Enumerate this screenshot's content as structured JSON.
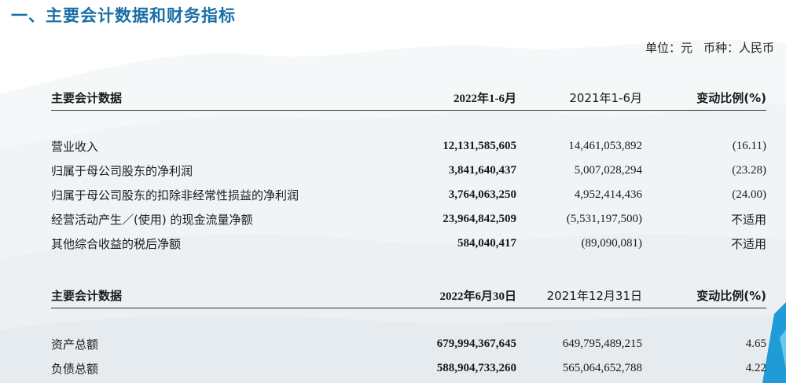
{
  "section_title": "一、主要会计数据和财务指标",
  "unit": {
    "unit_text": "单位：元",
    "currency_text": "币种：人民币"
  },
  "table1": {
    "headers": [
      "主要会计数据",
      "2022年1-6月",
      "2021年1-6月",
      "变动比例(%)"
    ],
    "rows": [
      [
        "营业收入",
        "12,131,585,605",
        "14,461,053,892",
        "(16.11)"
      ],
      [
        "归属于母公司股东的净利润",
        "3,841,640,437",
        "5,007,028,294",
        "(23.28)"
      ],
      [
        "归属于母公司股东的扣除非经常性损益的净利润",
        "3,764,063,250",
        "4,952,414,436",
        "(24.00)"
      ],
      [
        "经营活动产生／(使用) 的现金流量净额",
        "23,964,842,509",
        "(5,531,197,500)",
        "不适用"
      ],
      [
        "其他综合收益的税后净额",
        "584,040,417",
        "(89,090,081)",
        "不适用"
      ]
    ]
  },
  "table2": {
    "headers": [
      "主要会计数据",
      "2022年6月30日",
      "2021年12月31日",
      "变动比例(%)"
    ],
    "rows": [
      [
        "资产总额",
        "679,994,367,645",
        "649,795,489,215",
        "4.65"
      ],
      [
        "负债总额",
        "588,904,733,260",
        "565,064,652,788",
        "4.22"
      ]
    ]
  }
}
